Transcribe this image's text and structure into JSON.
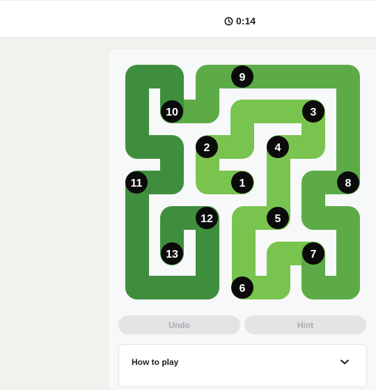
{
  "header": {
    "timer_icon": "clock-icon",
    "timer": "0:14"
  },
  "puzzle": {
    "numbers": [
      "1",
      "2",
      "3",
      "4",
      "5",
      "6",
      "7",
      "8",
      "9",
      "10",
      "11",
      "12",
      "13"
    ],
    "colors": {
      "light": "#79c44f",
      "mid": "#5cab47",
      "dark": "#3f8e3e",
      "dot": "#0b0b0b"
    }
  },
  "controls": {
    "undo_label": "Undo",
    "hint_label": "Hint"
  },
  "how_to_play": {
    "label": "How to play",
    "icon": "chevron-down-icon"
  }
}
